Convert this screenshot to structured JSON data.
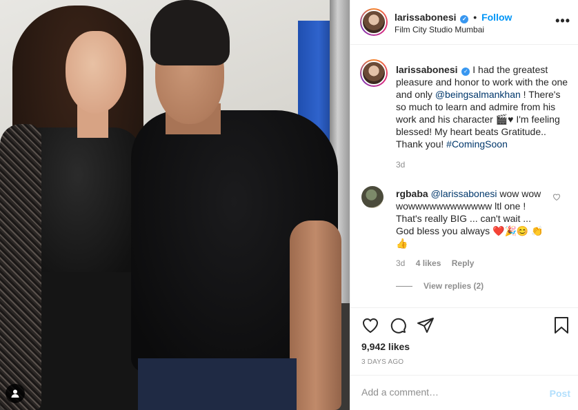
{
  "post": {
    "username": "larissabonesi",
    "dot": "•",
    "follow_label": "Follow",
    "location": "Film City Studio Mumbai",
    "more_label": "•••"
  },
  "caption": {
    "username": "larissabonesi",
    "text_1": "I had the greatest pleasure and honor to work with the one and only ",
    "mention": "@beingsalmankhan",
    "text_2": " ! There's so much to learn and admire from his work and his character 🎬♥ I'm feeling blessed! My heart beats Gratitude.. Thank you! ",
    "hashtag": "#ComingSoon",
    "age": "3d"
  },
  "comment": {
    "username": "rgbaba",
    "mention": "@larissabonesi",
    "text": " wow wow wowwwwwwwwwwww ltl one ! That's really BIG ... can't wait ... God bless you always ❤️🎉😊 👏👍",
    "age": "3d",
    "likes": "4 likes",
    "reply_label": "Reply",
    "view_replies": "View replies (2)"
  },
  "engagement": {
    "likes": "9,942 likes",
    "date": "3 DAYS AGO"
  },
  "composer": {
    "placeholder": "Add a comment…",
    "post_label": "Post"
  },
  "icons": {
    "verified": "verified-badge",
    "like": "heart-icon",
    "comment": "comment-bubble-icon",
    "share": "paper-plane-icon",
    "save": "bookmark-icon",
    "tagged": "user-tag-icon"
  },
  "colors": {
    "link_blue": "#0095f6",
    "mention_blue": "#00376b",
    "muted": "#8e8e8e",
    "text": "#262626"
  }
}
